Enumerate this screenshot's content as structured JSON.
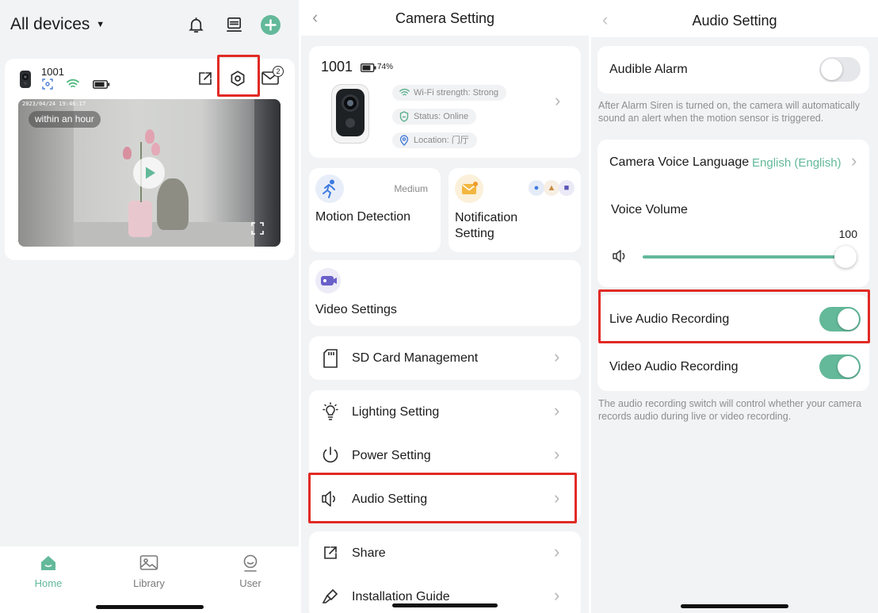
{
  "panel1": {
    "title": "All devices",
    "device": {
      "name": "1001",
      "timestamp": "2023/04/24 19:46:17",
      "badge": "within an hour",
      "message_count": "2"
    },
    "nav": [
      {
        "label": "Home",
        "icon": "home-icon",
        "active": true
      },
      {
        "label": "Library",
        "icon": "image-icon",
        "active": false
      },
      {
        "label": "User",
        "icon": "user-icon",
        "active": false
      }
    ]
  },
  "panel2": {
    "title": "Camera Setting",
    "camera": {
      "name": "1001",
      "battery": "74%",
      "wifi": "Wi-Fi strength: Strong",
      "status": "Status: Online",
      "location": "Location: 门厅"
    },
    "motion": {
      "label": "Motion Detection",
      "level": "Medium"
    },
    "notification": {
      "label": "Notification Setting"
    },
    "video": {
      "label": "Video Settings"
    },
    "sd_card": "SD Card Management",
    "lighting": "Lighting Setting",
    "power": "Power Setting",
    "audio": "Audio Setting",
    "share": "Share",
    "installation": "Installation Guide"
  },
  "panel3": {
    "title": "Audio Setting",
    "audible_alarm": {
      "label": "Audible Alarm",
      "enabled": false
    },
    "alarm_help": "After Alarm Siren is turned on, the camera will automatically sound an alert when the motion sensor is triggered.",
    "voice_language": {
      "label": "Camera Voice Language",
      "value": "English (English)"
    },
    "voice_volume": {
      "label": "Voice Volume",
      "value": "100",
      "level": 1.0
    },
    "live_audio": {
      "label": "Live Audio Recording",
      "enabled": true
    },
    "video_audio": {
      "label": "Video Audio Recording",
      "enabled": true
    },
    "recording_help": "The audio recording switch will control whether your camera records audio during live or video recording."
  },
  "colors": {
    "accent": "#63b99a",
    "highlight": "#e12a25",
    "background": "#f2f3f5"
  }
}
